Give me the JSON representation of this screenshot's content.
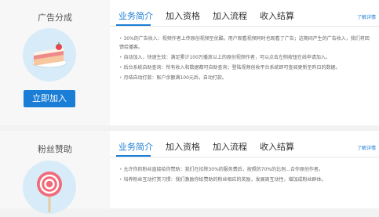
{
  "card1": {
    "title": "广告分成",
    "button": "立即加入",
    "tabs": [
      "业务简介",
      "加入资格",
      "加入流程",
      "收入结算"
    ],
    "more": "了解详情",
    "bullets": [
      "30%的广告收入：视频作者上传原创视频至优酷，用户观看视频同时也观看了广告；这期间产生的广告收入，我们将回馈给播客。",
      "自动加入，快速生效：满足累计100万播放以上的原创视频作者，可以点击左侧按钮在线申请加入。",
      "后台系统自助查询：所有收入和数据都可自助查询；登陆视频创收平台系统即可查阅更新至昨日的数据。",
      "月结自动打款：账户余额满100元后，自动打款。"
    ]
  },
  "card2": {
    "title": "粉丝赞助",
    "tabs": [
      "业务简介",
      "加入资格",
      "加入流程",
      "收入结算"
    ],
    "more": "了解详情",
    "bullets": [
      "允许你的粉丝直接给你赞助：我们在扣除30%的服务费后，按照的70%的比例...合作原创作者。",
      "培养粉丝互动打赏习惯：我们激励你给赞助的粉丝相应的奖励，发展周互动性，增加成粉丝群体。"
    ]
  },
  "colors": {
    "accent": "#1b7ed6",
    "circle_bg": "#d7ecf8",
    "left_bg": "#f7f7f7"
  },
  "icons": {
    "card1": "cake-icon",
    "card2": "lollipop-icon"
  }
}
